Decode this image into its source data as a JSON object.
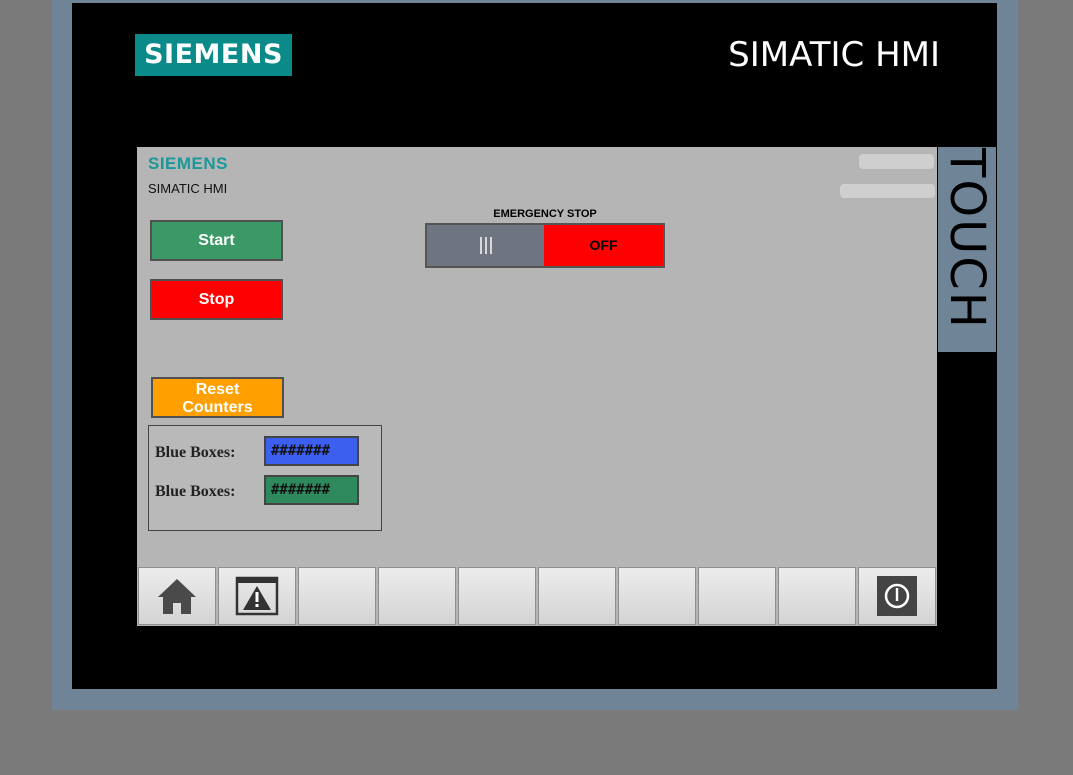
{
  "bezel": {
    "brand": "SIEMENS",
    "title": "SIMATIC HMI",
    "side_label": "TOUCH"
  },
  "screen": {
    "brand": "SIEMENS",
    "subtitle": "SIMATIC HMI",
    "buttons": {
      "start": "Start",
      "stop": "Stop",
      "reset": "Reset\nCounters"
    },
    "emergency_stop": {
      "label": "EMERGENCY STOP",
      "state": "OFF"
    },
    "counters": [
      {
        "label": "Blue Boxes:",
        "value": "#######",
        "color": "#3c5ff0"
      },
      {
        "label": "Blue Boxes:",
        "value": "#######",
        "color": "#2e8a5c"
      }
    ],
    "softkeys": [
      "home-icon",
      "alarm-icon",
      "",
      "",
      "",
      "",
      "",
      "",
      "",
      "power-icon"
    ]
  },
  "colors": {
    "brand_teal": "#0b8a8a",
    "start_green": "#3a9966",
    "stop_red": "#ff0000",
    "reset_orange": "#ffa000"
  }
}
